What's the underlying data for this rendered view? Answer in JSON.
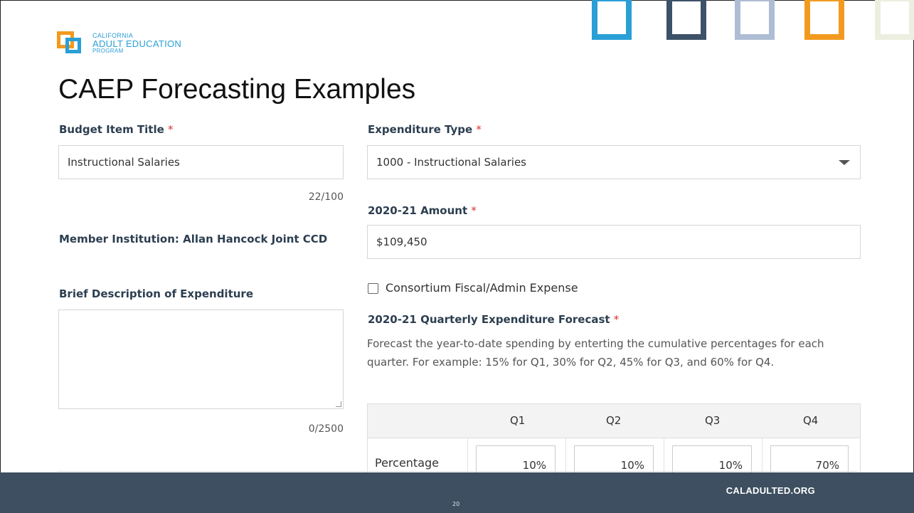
{
  "logo": {
    "line1": "CALIFORNIA",
    "line2": "ADULT EDUCATION",
    "line3": "PROGRAM",
    "colors": {
      "orange": "#f29a1f",
      "blue": "#2a9fd6"
    }
  },
  "slide": {
    "title": "CAEP Forecasting Examples",
    "page_number": "20",
    "footer_url": "CALADULTED.ORG"
  },
  "form": {
    "required_mark": "*",
    "budget_item": {
      "label": "Budget Item Title",
      "value": "Instructional Salaries",
      "counter": "22/100"
    },
    "expenditure_type": {
      "label": "Expenditure Type",
      "selected": "1000 - Instructional Salaries"
    },
    "amount": {
      "label": "2020-21 Amount",
      "value": "$109,450"
    },
    "member_institution": {
      "label": "Member Institution: Allan Hancock Joint CCD"
    },
    "description": {
      "label": "Brief Description of Expenditure",
      "value": "",
      "counter": "0/2500"
    },
    "consortium_checkbox": {
      "label": "Consortium Fiscal/Admin Expense",
      "checked": false
    },
    "forecast": {
      "label": "2020-21 Quarterly Expenditure Forecast",
      "help": "Forecast the year-to-date spending by enterting the cumulative percentages for each quarter. For example: 15% for Q1, 30% for Q2, 45% for Q3, and 60% for Q4.",
      "columns": [
        "Q1",
        "Q2",
        "Q3",
        "Q4"
      ],
      "row_label": "Percentage",
      "values": [
        "10%",
        "10%",
        "10%",
        "70%"
      ]
    }
  },
  "colors": {
    "accent_required": "#d9342b",
    "footer": "#3d4f60",
    "squares": [
      "#2a9fd6",
      "#3d5168",
      "#aebdd3",
      "#f29a1f",
      "#eceee0"
    ]
  }
}
